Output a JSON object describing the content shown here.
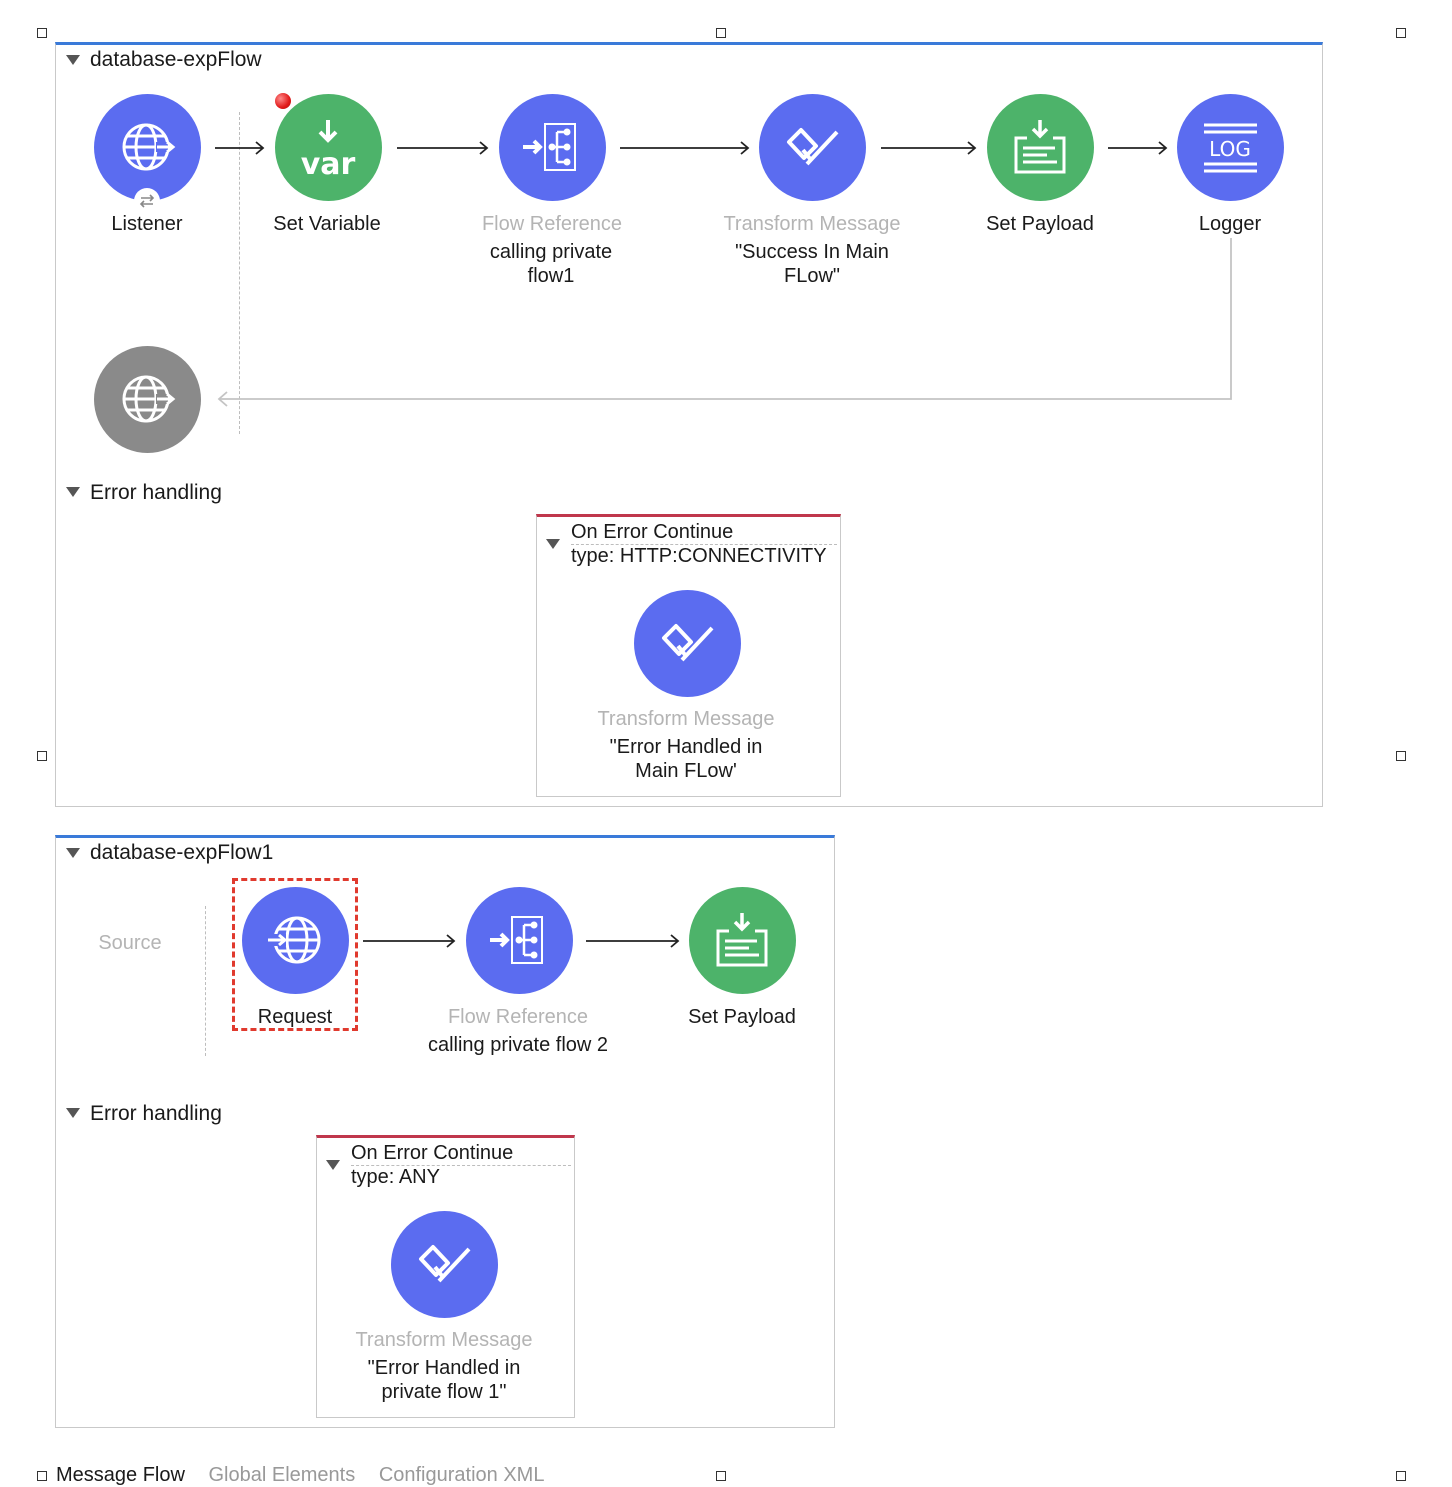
{
  "flow1": {
    "title": "database-expFlow",
    "nodes": {
      "listener": {
        "label": "Listener",
        "icon": "globe-arrow-icon"
      },
      "set_variable": {
        "label": "Set Variable",
        "icon": "var-icon"
      },
      "flow_reference": {
        "type": "Flow Reference",
        "label": "calling private flow1",
        "icon": "flow-reference-icon"
      },
      "transform": {
        "type": "Transform Message",
        "label": "\"Success In Main FLow\"",
        "icon": "dataweave-icon"
      },
      "set_payload": {
        "label": "Set Payload",
        "icon": "set-payload-icon"
      },
      "logger": {
        "label": "Logger",
        "icon": "log-icon"
      }
    },
    "error_section": "Error handling",
    "error_handler": {
      "title": "On Error Continue",
      "type": "type: HTTP:CONNECTIVITY",
      "node_type": "Transform Message",
      "node_label": "\"Error Handled in Main FLow'"
    }
  },
  "flow2": {
    "title": "database-expFlow1",
    "source_label": "Source",
    "nodes": {
      "request": {
        "label": "Request",
        "icon": "globe-request-icon"
      },
      "flow_reference": {
        "type": "Flow Reference",
        "label": "calling private flow 2",
        "icon": "flow-reference-icon"
      },
      "set_payload": {
        "label": "Set Payload",
        "icon": "set-payload-icon"
      }
    },
    "error_section": "Error handling",
    "error_handler": {
      "title": "On Error Continue",
      "type": "type: ANY",
      "node_type": "Transform Message",
      "node_label": "\"Error Handled in private flow 1\""
    }
  },
  "bottom_tabs": {
    "message_flow": "Message Flow",
    "global_elements": "Global Elements",
    "configuration_xml": "Configuration XML"
  },
  "colors": {
    "processor_blue": "#5b6cf0",
    "transformer_green": "#4db36a",
    "source_gray": "#8a8a8a",
    "flow_border": "#3a7ad9",
    "error_border": "#c0374c",
    "selection": "#e03a2e"
  }
}
